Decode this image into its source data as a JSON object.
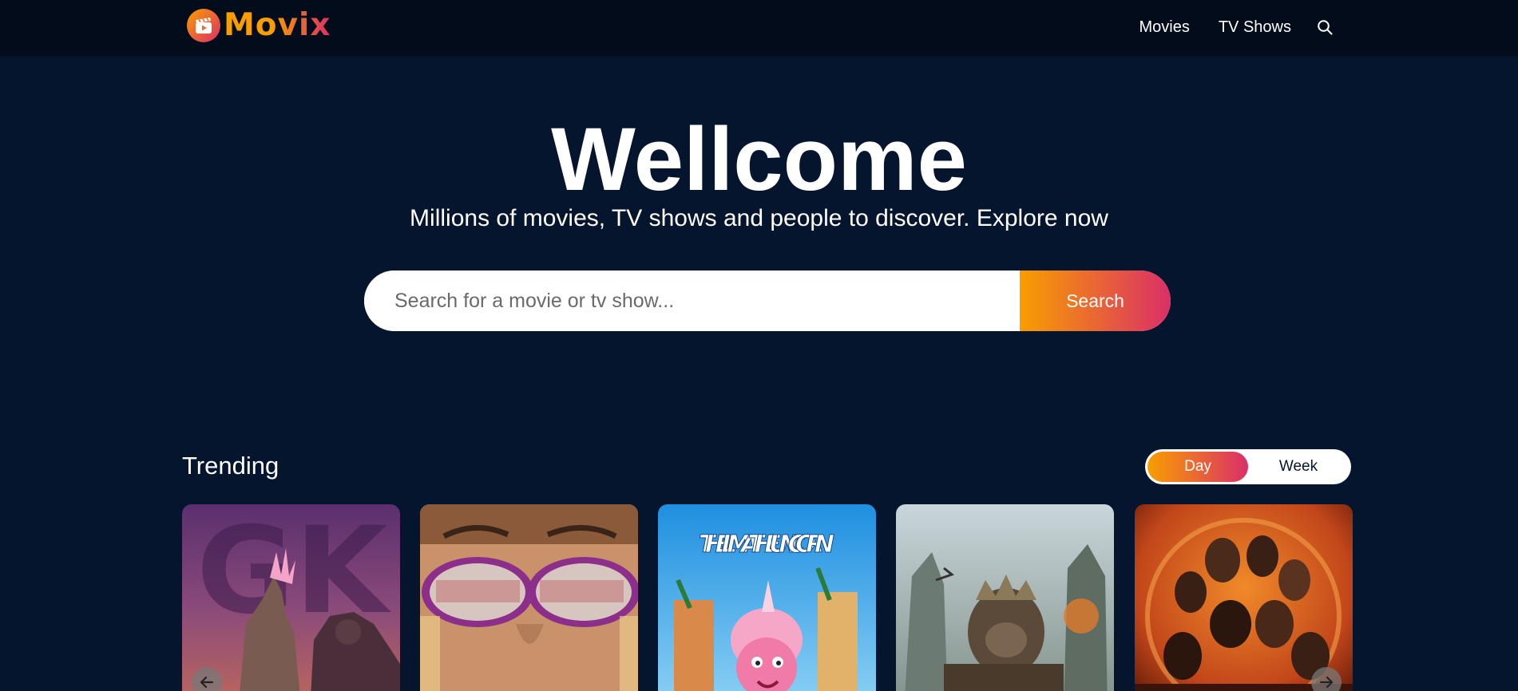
{
  "header": {
    "logo_text": "Movix",
    "nav": [
      {
        "label": "Movies"
      },
      {
        "label": "TV Shows"
      }
    ],
    "search_icon": "search-icon"
  },
  "hero": {
    "title": "Wellcome",
    "subtitle": "Millions of movies, TV shows and people to discover. Explore now",
    "search_placeholder": "Search for a movie or tv show...",
    "search_button": "Search"
  },
  "trending": {
    "title": "Trending",
    "tabs": [
      {
        "label": "Day",
        "active": true
      },
      {
        "label": "Week",
        "active": false
      }
    ],
    "posters": [
      {
        "art_text": "GK"
      },
      {
        "art_text": ""
      },
      {
        "art_text": "THELMA THE UNICORN"
      },
      {
        "art_text": ""
      },
      {
        "art_text": ""
      }
    ],
    "arrows": [
      "arrow-left-icon",
      "arrow-right-icon"
    ]
  },
  "colors": {
    "background": "#04152d",
    "header": "#020c1b",
    "gradient_start": "#f89e00",
    "gradient_end": "#da2f68"
  }
}
